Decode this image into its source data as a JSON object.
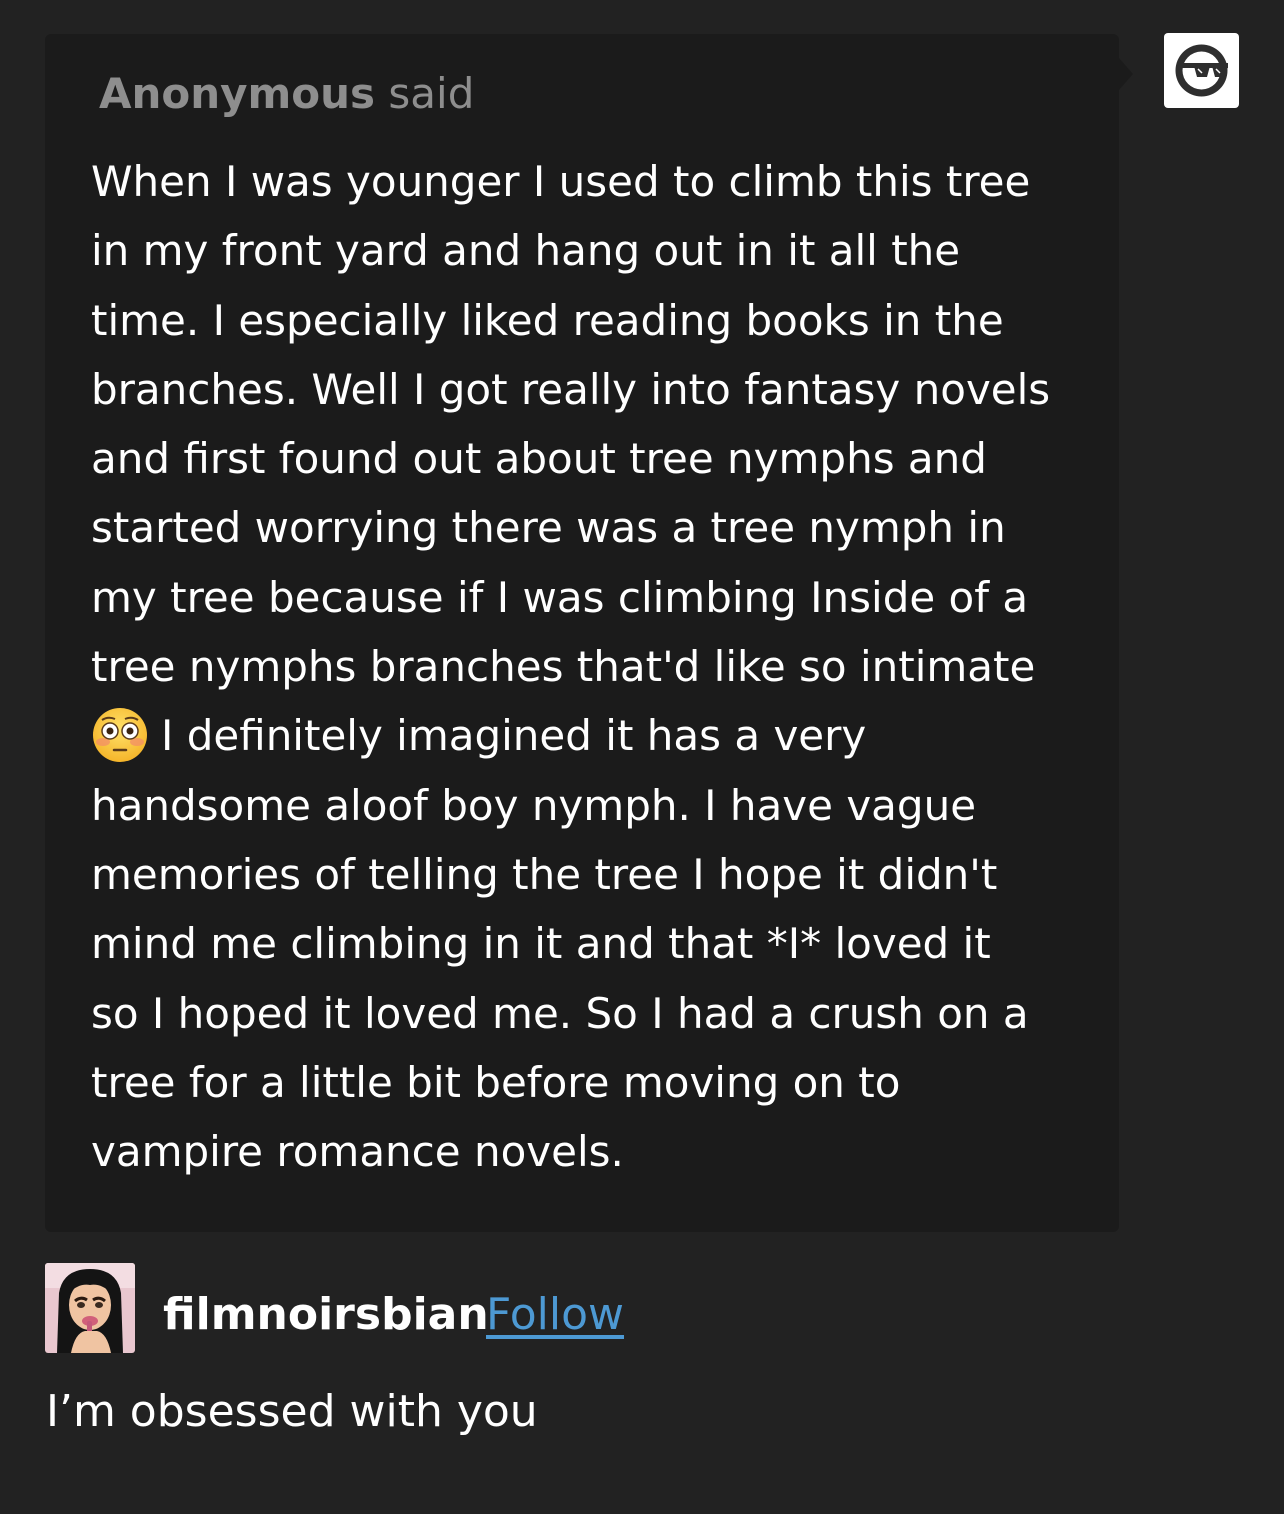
{
  "ask": {
    "asker_name": "Anonymous",
    "asker_suffix": " said",
    "body_lines": [
      "When I was younger I used to climb this tree",
      "in my front yard and hang out in it all the",
      "time. I especially liked reading books in the",
      "branches. Well I got really into fantasy novels",
      "and first found out about tree nymphs and",
      "started worrying there was a tree nymph in",
      "my tree because if I was climbing Inside of a",
      "tree nymphs branches that'd like so intimate",
      "I definitely imagined it has a very",
      "handsome aloof boy nymph. I have vague",
      "memories of telling the tree I hope it didn't",
      "mind me climbing in it and that *I* loved it",
      "so I hoped it loved me. So I had a crush on a",
      "tree for a little bit before moving on to",
      "vampire romance novels."
    ],
    "emoji": "flushed-face",
    "avatar_icon": "anonymous-sunglasses-icon"
  },
  "reply": {
    "username": "filmnoirsbian",
    "follow_label": "Follow",
    "text": "I’m obsessed with you"
  },
  "colors": {
    "background": "#222222",
    "bubble": "#1b1b1b",
    "asker": "#8e8e8e",
    "link": "#4d99d3"
  }
}
